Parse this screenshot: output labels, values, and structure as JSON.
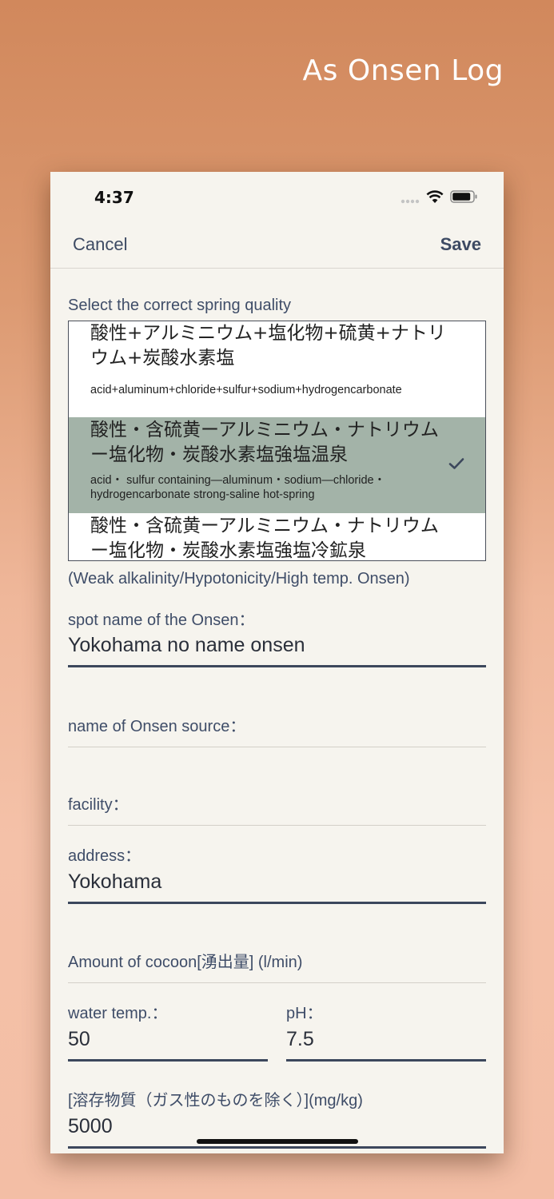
{
  "banner": {
    "title": "As Onsen Log"
  },
  "status_bar": {
    "time": "4:37"
  },
  "nav": {
    "cancel_label": "Cancel",
    "save_label": "Save"
  },
  "spring_quality": {
    "label": "Select the correct spring quality",
    "options": [
      {
        "jp": "酸性+アルミニウム+塩化物+硫黄+ナトリウム+炭酸水素塩",
        "en": "acid+aluminum+chloride+sulfur+sodium+hydrogencarbonate",
        "selected": false
      },
      {
        "jp": "酸性・含硫黄ーアルミニウム・ナトリウムー塩化物・炭酸水素塩強塩温泉",
        "en": "acid・ sulfur containing—aluminum・sodium—chloride・hydrogencarbonate strong-saline hot-spring",
        "selected": true
      },
      {
        "jp": "酸性・含硫黄ーアルミニウム・ナトリウムー塩化物・炭酸水素塩強塩冷鉱泉",
        "en": "",
        "selected": false
      }
    ],
    "summary": "(Weak alkalinity/Hypotonicity/High temp. Onsen)"
  },
  "fields": {
    "spot_name": {
      "label": "spot name of the Onsen：",
      "value": "Yokohama no name onsen"
    },
    "source_name": {
      "label": "name of Onsen source：",
      "value": ""
    },
    "facility": {
      "label": "facility：",
      "value": ""
    },
    "address": {
      "label": "address：",
      "value": "Yokohama"
    },
    "amount": {
      "label": "Amount of cocoon[湧出量] (l/min)",
      "value": ""
    },
    "water_temp": {
      "label": "water temp.：",
      "value": "50"
    },
    "ph": {
      "label": "pH：",
      "value": "7.5"
    },
    "dissolved": {
      "label": "[溶存物質（ガス性のものを除く）](mg/kg)",
      "value": "5000"
    }
  },
  "colors": {
    "accent": "#3c475c",
    "selected_row": "#a3b3a8",
    "screen_bg": "#f6f4ee"
  }
}
